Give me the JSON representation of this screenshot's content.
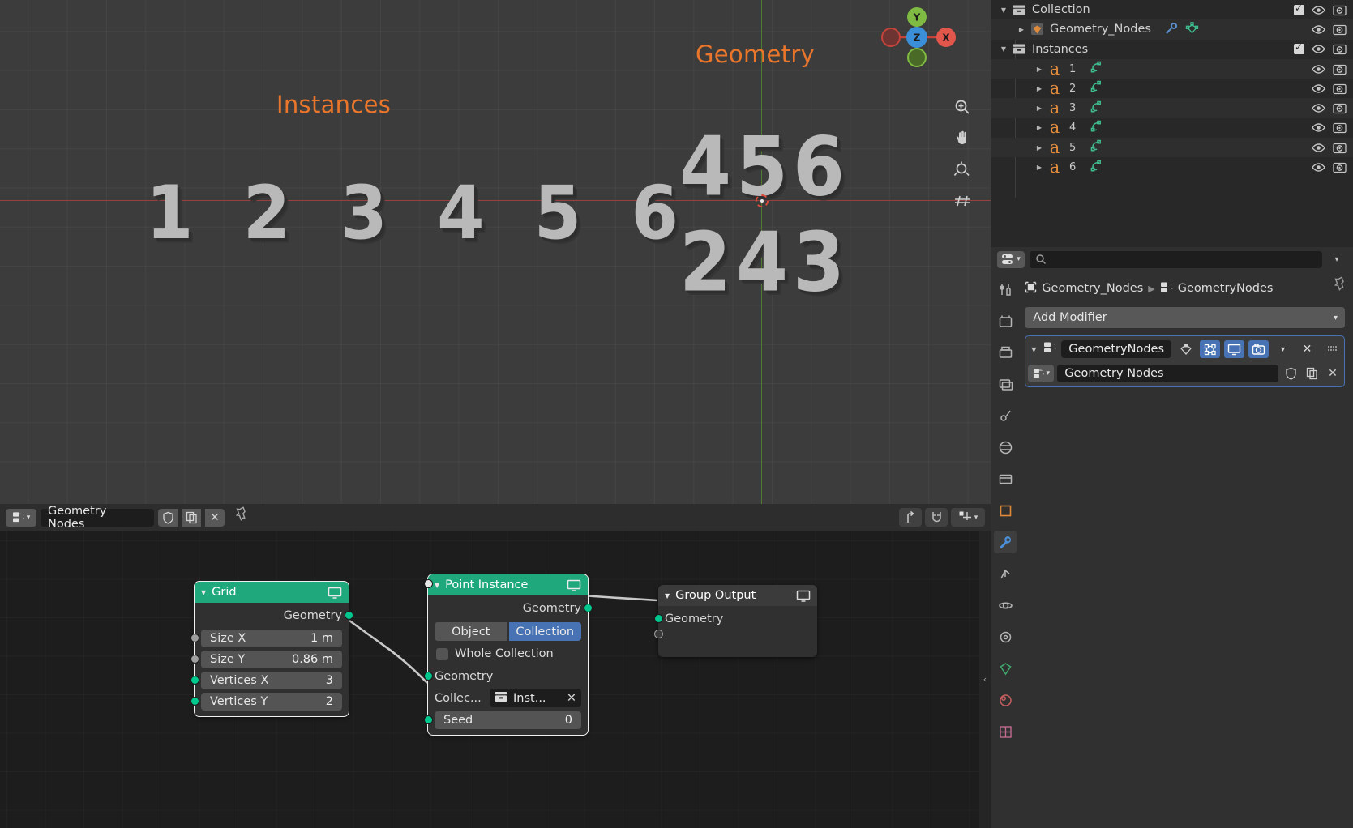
{
  "viewport": {
    "labels": [
      {
        "text": "Instances",
        "name": "viewport-label-instances"
      },
      {
        "text": "Geometry",
        "name": "viewport-label-geometry"
      }
    ],
    "instances_numbers": "1 2 3 4 5 6",
    "geometry_numbers_row1": "456",
    "geometry_numbers_row2": "243",
    "accent_orange": "#e9762a",
    "gizmo": {
      "x": "X",
      "y": "Y",
      "z": "Z",
      "x_color": "#e2564c",
      "y_color": "#7fbb42",
      "z_color": "#3b8fd8"
    },
    "tools": [
      "zoom-icon",
      "hand-icon",
      "camera-icon",
      "grid-icon"
    ]
  },
  "outliner": {
    "rows": [
      {
        "label": "Collection",
        "icon": "collection-icon",
        "indent": 0,
        "tri": "down",
        "checkbox": true,
        "eye": true,
        "camera": true
      },
      {
        "label": "Geometry_Nodes",
        "icon": "mesh-object-icon",
        "indent": 1,
        "tri": "right",
        "checkbox": false,
        "eye": true,
        "camera": true,
        "extra": [
          "wrench-icon",
          "mesh-data-icon"
        ]
      },
      {
        "label": "Instances",
        "icon": "collection-icon",
        "indent": 0,
        "tri": "down",
        "checkbox": true,
        "eye": true,
        "camera": true
      },
      {
        "label": "1",
        "icon": "font-object-icon",
        "indent": 2,
        "tri": "right",
        "checkbox": false,
        "eye": true,
        "camera": true,
        "extra": [
          "curve-data-icon"
        ]
      },
      {
        "label": "2",
        "icon": "font-object-icon",
        "indent": 2,
        "tri": "right",
        "checkbox": false,
        "eye": true,
        "camera": true,
        "extra": [
          "curve-data-icon"
        ]
      },
      {
        "label": "3",
        "icon": "font-object-icon",
        "indent": 2,
        "tri": "right",
        "checkbox": false,
        "eye": true,
        "camera": true,
        "extra": [
          "curve-data-icon"
        ]
      },
      {
        "label": "4",
        "icon": "font-object-icon",
        "indent": 2,
        "tri": "right",
        "checkbox": false,
        "eye": true,
        "camera": true,
        "extra": [
          "curve-data-icon"
        ]
      },
      {
        "label": "5",
        "icon": "font-object-icon",
        "indent": 2,
        "tri": "right",
        "checkbox": false,
        "eye": true,
        "camera": true,
        "extra": [
          "curve-data-icon"
        ]
      },
      {
        "label": "6",
        "icon": "font-object-icon",
        "indent": 2,
        "tri": "right",
        "checkbox": false,
        "eye": true,
        "camera": true,
        "extra": [
          "curve-data-icon"
        ]
      }
    ]
  },
  "properties": {
    "search_placeholder": "",
    "breadcrumb": {
      "object": "Geometry_Nodes",
      "modifier": "GeometryNodes"
    },
    "add_modifier": "Add Modifier",
    "modifier": {
      "name": "GeometryNodes",
      "toggles": [
        {
          "name": "edit-mode-display-toggle",
          "state": "off",
          "icon": "vertex-icon"
        },
        {
          "name": "show-on-cage-toggle",
          "state": "on",
          "icon": "cage-icon"
        },
        {
          "name": "realtime-display-toggle",
          "state": "on",
          "icon": "monitor-icon"
        },
        {
          "name": "render-display-toggle",
          "state": "on",
          "icon": "camera-icon"
        }
      ],
      "node_group": "Geometry Nodes"
    },
    "accent_blue": "#4772b3"
  },
  "node_editor": {
    "header": {
      "editor_type": "geometry-nodes-editor",
      "tree_name": "Geometry Nodes",
      "icons": [
        "shield-icon",
        "duplicate-icon",
        "close-icon",
        "pin-icon"
      ],
      "right_icons": [
        "parent-up-icon",
        "snap-magnet-icon",
        "proportional-edit-icon"
      ]
    },
    "nodes": [
      {
        "name": "grid-node",
        "title": "Grid",
        "header_color": "#1fa87c",
        "outputs": [
          {
            "label": "Geometry",
            "socket": "green"
          }
        ],
        "fields": [
          {
            "label": "Size X",
            "value": "1 m",
            "socket": "grey"
          },
          {
            "label": "Size Y",
            "value": "0.86 m",
            "socket": "grey"
          },
          {
            "label": "Vertices X",
            "value": "3",
            "socket": "green"
          },
          {
            "label": "Vertices Y",
            "value": "2",
            "socket": "green"
          }
        ]
      },
      {
        "name": "point-instance-node",
        "title": "Point Instance",
        "header_color": "#1fa87c",
        "outputs": [
          {
            "label": "Geometry",
            "socket": "green"
          }
        ],
        "toggle": {
          "left": "Object",
          "right": "Collection",
          "active": "Collection"
        },
        "checkbox": {
          "label": "Whole Collection",
          "checked": false
        },
        "inputs": [
          {
            "label": "Geometry",
            "socket": "green"
          }
        ],
        "collection": {
          "label": "Collec...",
          "value": "Inst...",
          "icon": "collection-icon"
        },
        "seed": {
          "label": "Seed",
          "value": "0",
          "socket": "green"
        }
      },
      {
        "name": "group-output-node",
        "title": "Group Output",
        "header_color": "#3b3b3b",
        "inputs": [
          {
            "label": "Geometry",
            "socket": "green"
          },
          {
            "label": "",
            "socket": "white"
          }
        ]
      }
    ]
  }
}
